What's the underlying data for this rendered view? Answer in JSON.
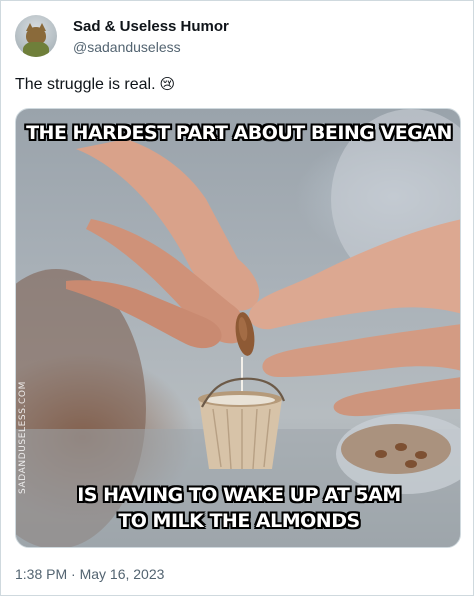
{
  "user": {
    "display_name": "Sad & Useless Humor",
    "handle": "@sadanduseless",
    "avatar_icon": "cat-avatar-icon"
  },
  "tweet": {
    "text": "The struggle is real.",
    "emoji": "😢",
    "timestamp": "1:38 PM · May 16, 2023"
  },
  "media": {
    "top_caption": "THE HARDEST PART ABOUT BEING VEGAN",
    "bottom_caption_line1": "IS HAVING TO WAKE UP AT 5AM",
    "bottom_caption_line2": "TO MILK THE ALMONDS",
    "watermark": "SADANDUSELESS.COM"
  }
}
